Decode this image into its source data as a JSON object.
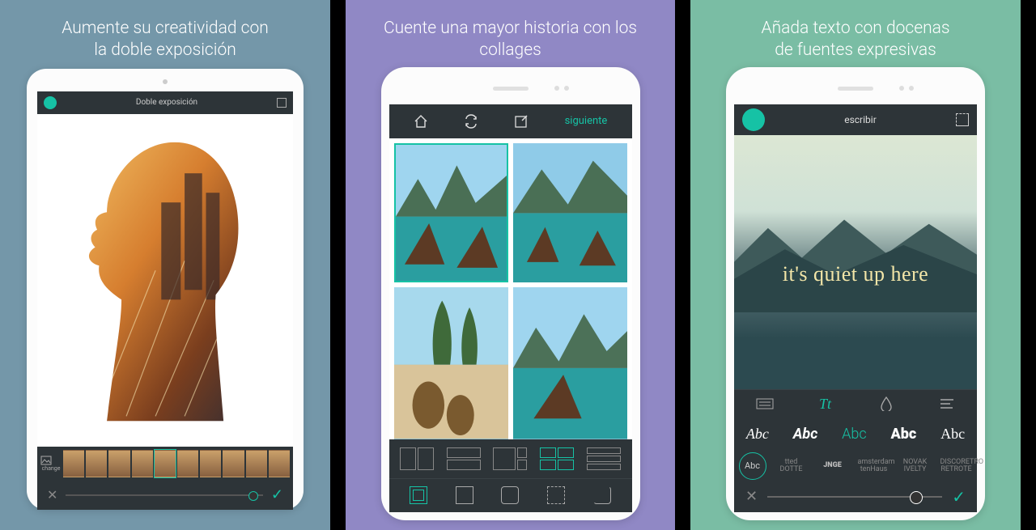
{
  "panels": [
    {
      "heading_line1": "Aumente su creatividad con",
      "heading_line2": "la doble exposición",
      "app_title": "Doble exposición",
      "change_label": "change"
    },
    {
      "heading": "Cuente una mayor historia con los collages",
      "next_label": "siguiente"
    },
    {
      "heading_line1": "Añada texto con docenas",
      "heading_line2": "de fuentes expresivas",
      "app_title": "escribir",
      "overlay_text": "it's quiet up here",
      "font_samples": [
        "Abc",
        "Abc",
        "Abc",
        "Abc",
        "Abc"
      ],
      "font_chips": [
        "Abc",
        "tted DOTTE",
        "JNGE",
        "amsterdam tenHaus",
        "NOVAK IVELTY",
        "DISCORETRO RETROTE"
      ]
    }
  ]
}
